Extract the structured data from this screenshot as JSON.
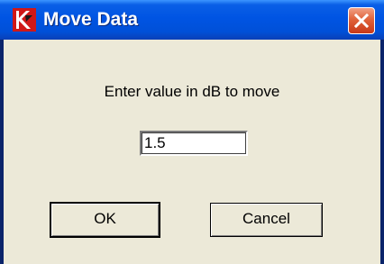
{
  "window": {
    "title": "Move Data",
    "icon": "app-logo-icon",
    "close_icon": "close-icon"
  },
  "dialog": {
    "prompt": "Enter value in dB to move",
    "input_value": "1.5",
    "ok_label": "OK",
    "cancel_label": "Cancel"
  },
  "colors": {
    "titlebar": "#0054e3",
    "face": "#ece9d8",
    "close": "#e0623a",
    "logo": "#d01818"
  }
}
